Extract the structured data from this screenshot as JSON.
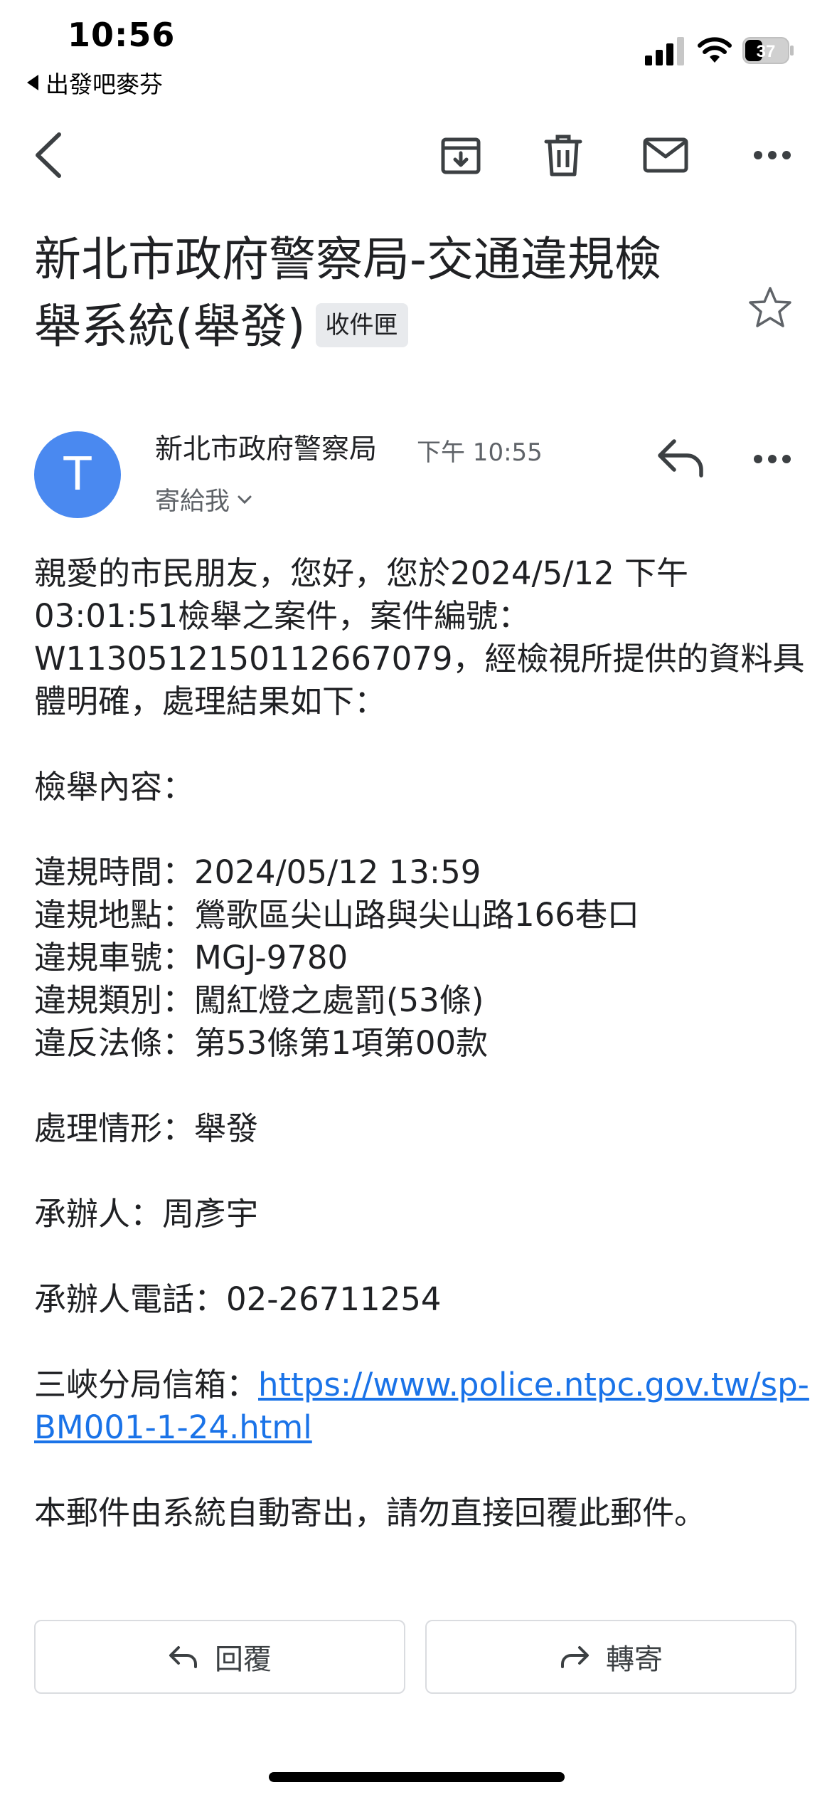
{
  "status_bar": {
    "time": "10:56",
    "back_app": "出發吧麥芬",
    "battery": "37"
  },
  "toolbar": {
    "icons": [
      "back-arrow-icon",
      "archive-icon",
      "trash-icon",
      "mail-icon",
      "more-icon"
    ]
  },
  "email": {
    "subject": "新北市政府警察局-交通違規檢舉系統(舉發)",
    "label": "收件匣",
    "sender_initial": "T",
    "sender_name": "新北市政府警察局",
    "sent_time": "下午 10:55",
    "recipient": "寄給我",
    "body": {
      "greeting": "親愛的市民朋友，您好，您於2024/5/12 下午03:01:51檢舉之案件，案件編號：W1130512150112667079，經檢視所提供的資料具體明確，處理結果如下：",
      "section_title": "檢舉內容：",
      "details": [
        "違規時間：2024/05/12 13:59",
        "違規地點：鶯歌區尖山路與尖山路166巷口",
        "違規車號：MGJ-9780",
        "違規類別：闖紅燈之處罰(53條)",
        "違反法條：第53條第1項第00款"
      ],
      "status": "處理情形：舉發",
      "handler": "承辦人：周彥宇",
      "handler_phone": "承辦人電話：02-26711254",
      "mailbox_label": "三峽分局信箱：",
      "mailbox_url": "https://www.police.ntpc.gov.tw/sp-BM001-1-24.html",
      "footer_note": "本郵件由系統自動寄出，請勿直接回覆此郵件。"
    }
  },
  "actions": {
    "reply_label": "回覆",
    "forward_label": "轉寄"
  },
  "colors": {
    "avatar": "#4a89f0",
    "link": "#1a73e8",
    "label_chip": "#e8eaed"
  }
}
